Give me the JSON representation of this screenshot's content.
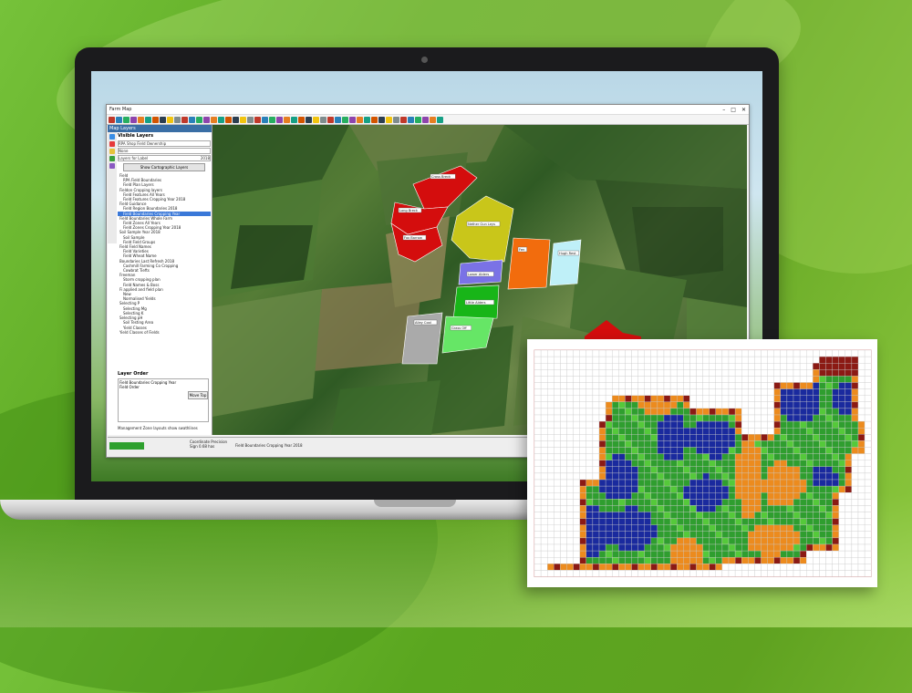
{
  "window": {
    "title": "Farm Map"
  },
  "sidebar": {
    "header": "Map Layers",
    "section_title": "Visible Layers",
    "selector_value": "RPA Shop Field Ownership",
    "checkbox_label": "None",
    "layers_label": "Layers for Label",
    "layers_value": "2018",
    "show_button": "Show Cartographic Layers",
    "tree": [
      "Field",
      "RPA Field Boundaries",
      "Field Plan Layers",
      "Fieldon Cropping layers",
      "Field Features All Years",
      "Field Features Cropping Year 2018",
      "Field Guidance",
      "Field Region Boundaries 2018",
      "Field Boundaries Cropping Year",
      "Field Boundaries Whole Farm",
      "Field Zones All Years",
      "Field Zones Cropping Year 2018",
      "Soil Sample Year 2018",
      "Soil Sample",
      "Field Field Groups",
      "Field Field Names",
      "Field Varieties",
      "Field Wheat Name",
      "Boundaries Last Refresh 2018",
      "Cashmill Farming Co Cropping",
      "Cowbrat Tiefts",
      "Freeman",
      "Storm cropping plan",
      "Field Names & Boss",
      "Fi applied and field plan",
      "New",
      "Normalised Yields",
      "Selecting P",
      "Selecting Mg",
      "Selecting K",
      "Selecting pH",
      "Soil Testing Area",
      "Yield Classes",
      "Yield Classes of Fields"
    ],
    "selected_index": 8,
    "layer_order_title": "Layer Order",
    "layer_order_items": [
      "Field Boundaries Cropping Year",
      "Field Order"
    ],
    "layer_order_button": "Move Top",
    "checkbox_bottom": "Management Zone layouts show swathlines"
  },
  "map": {
    "fields": [
      {
        "label": "Cross Breck",
        "color": "#d40d0d"
      },
      {
        "label": "Long Breck",
        "color": "#d40d0d"
      },
      {
        "label": "Fox Barrow",
        "color": "#d40d0d"
      },
      {
        "label": "Nether Gun Leys",
        "color": "#c9c61a"
      },
      {
        "label": "Lower Alders",
        "color": "#7a72e6"
      },
      {
        "label": "Little Alders",
        "color": "#18b518"
      },
      {
        "label": "Alley Cool",
        "color": "#aaaaaa"
      },
      {
        "label": "Grass Off",
        "color": "#66e666"
      },
      {
        "label": "Fen",
        "color": "#f26c0d"
      },
      {
        "label": "Hugh Rest",
        "color": "#bff0f8"
      }
    ]
  },
  "status": {
    "zoom": "",
    "coord_label": "Coordinate Precision",
    "coord_value": "Sign 0.68 has",
    "layer": "Field Boundaries Cropping Year 2018"
  },
  "grid_legend": {
    "colors": {
      "blue": "#1a2a9e",
      "green": "#2f9e2f",
      "lightgreen": "#55c93a",
      "orange": "#ec8b1e",
      "brown": "#8b1a14",
      "empty": "#ffffff"
    }
  }
}
